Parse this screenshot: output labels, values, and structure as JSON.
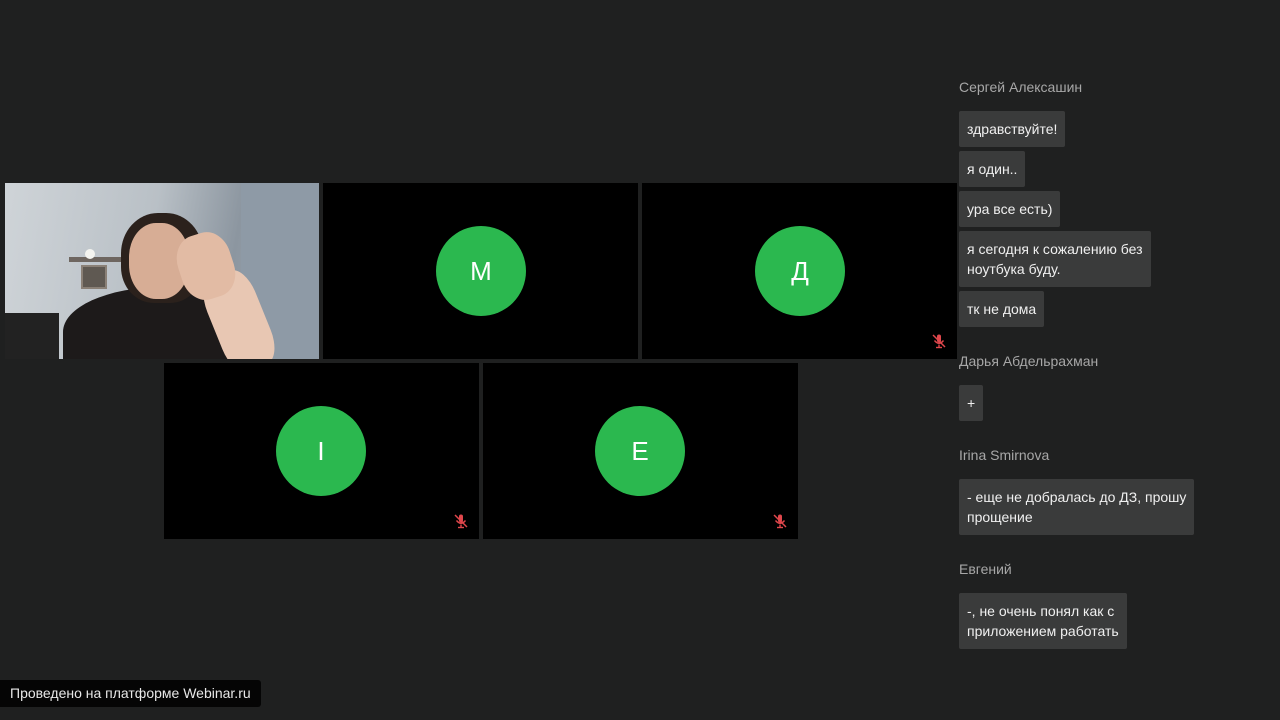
{
  "participants": [
    {
      "name": "camera",
      "type": "video"
    },
    {
      "initial": "М",
      "muted": false
    },
    {
      "initial": "Д",
      "muted": true
    },
    {
      "initial": "I",
      "muted": true
    },
    {
      "initial": "E",
      "muted": true
    }
  ],
  "chat": {
    "groups": [
      {
        "author": "Сергей Алексашин",
        "messages": [
          "здравствуйте!",
          "я один..",
          "ура все есть)",
          "я сегодня к сожалению без\nноутбука буду.",
          "тк не дома"
        ]
      },
      {
        "author": "Дарья Абдельрахман",
        "messages": [
          "+"
        ]
      },
      {
        "author": "Irina Smirnova",
        "messages": [
          "- еще не добралась до ДЗ, прошу\nпрощение"
        ]
      },
      {
        "author": "Евгений",
        "messages": [
          "-, не очень понял как с\nприложением работать"
        ]
      }
    ]
  },
  "footer": {
    "text": "Проведено на платформе Webinar.ru"
  },
  "colors": {
    "background": "#1f2020",
    "avatar": "#2bb84f",
    "muted_icon": "#e0474c",
    "message_bg": "#3a3b3b"
  }
}
